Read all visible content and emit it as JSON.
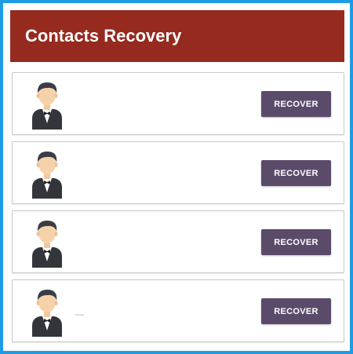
{
  "header": {
    "title": "Contacts Recovery"
  },
  "colors": {
    "frame_border": "#1f9be6",
    "header_bg": "#962a1f",
    "button_bg": "#5b4b6b"
  },
  "contacts": [
    {
      "avatar_icon": "waiter-avatar-icon",
      "name": "",
      "button_label": "RECOVER"
    },
    {
      "avatar_icon": "waiter-avatar-icon",
      "name": "",
      "button_label": "RECOVER"
    },
    {
      "avatar_icon": "waiter-avatar-icon",
      "name": "",
      "button_label": "RECOVER"
    },
    {
      "avatar_icon": "waiter-avatar-icon",
      "name": "—",
      "button_label": "RECOVER"
    }
  ]
}
